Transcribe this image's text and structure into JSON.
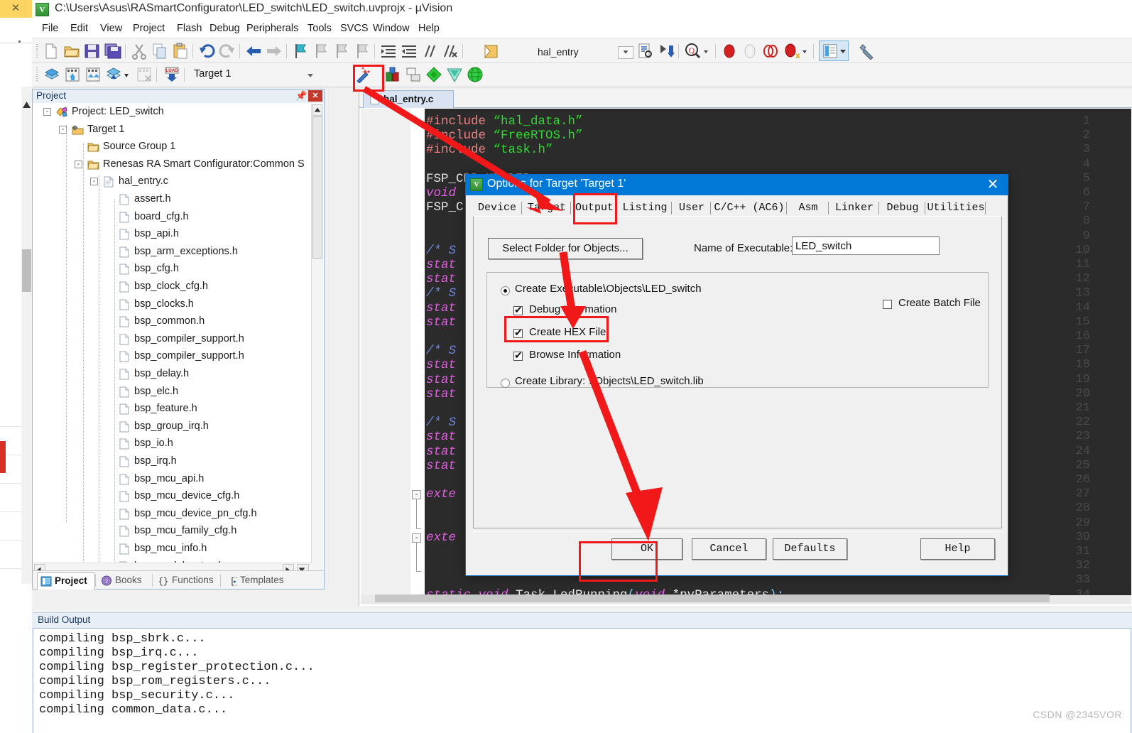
{
  "window": {
    "title": "C:\\Users\\Asus\\RASmartConfigurator\\LED_switch\\LED_switch.uvprojx - µVision",
    "app_icon_text": "V"
  },
  "menu": [
    "File",
    "Edit",
    "View",
    "Project",
    "Flash",
    "Debug",
    "Peripherals",
    "Tools",
    "SVCS",
    "Window",
    "Help"
  ],
  "toolbar": {
    "target_selected": "Target 1",
    "hal_entry_label": "hal_entry",
    "icons_row1": [
      "new-file-icon",
      "open-file-icon",
      "save-icon",
      "save-all-icon",
      "cut-icon",
      "copy-icon",
      "paste-icon",
      "undo-icon",
      "redo-icon",
      "back-icon",
      "forward-icon",
      "bookmark-icon",
      "bookmark-prev-icon",
      "bookmark-next-icon",
      "bookmark-clear-icon",
      "indent-icon",
      "outdent-icon",
      "comment-icon",
      "uncomment-icon",
      "notebook-icon",
      "find-in-files-icon",
      "insert-icon",
      "find-icon",
      "breakpoint-icon",
      "breakpoint-disable-icon",
      "breakpoint-clear-icon",
      "breakpoint-kill-icon",
      "window-layout-icon",
      "configure-icon"
    ],
    "icons_row2": [
      "translate-icon",
      "build-icon",
      "rebuild-icon",
      "batch-build-icon",
      "stop-build-icon",
      "download-icon",
      "wand-icon",
      "manage-runtime-icon",
      "manage-project-items-icon",
      "configuration-wizard-icon",
      "pack-installer-icon",
      "ra-configurator-icon"
    ]
  },
  "project_panel": {
    "title": "Project",
    "pin_icon": "pin-icon",
    "close_icon": "close-icon",
    "tree": [
      {
        "label": "Project: LED_switch",
        "depth": 0,
        "icon": "project-icon",
        "expander": "-"
      },
      {
        "label": "Target 1",
        "depth": 1,
        "icon": "target-folder-icon",
        "expander": "-"
      },
      {
        "label": "Source Group 1",
        "depth": 2,
        "icon": "folder-icon",
        "expander": ""
      },
      {
        "label": "Renesas RA Smart Configurator:Common S",
        "depth": 2,
        "icon": "folder-icon",
        "expander": "-"
      },
      {
        "label": "hal_entry.c",
        "depth": 3,
        "icon": "c-file-icon",
        "expander": "-"
      },
      {
        "label": "assert.h",
        "depth": 4,
        "icon": "header-file-icon",
        "expander": ""
      },
      {
        "label": "board_cfg.h",
        "depth": 4,
        "icon": "header-file-icon",
        "expander": ""
      },
      {
        "label": "bsp_api.h",
        "depth": 4,
        "icon": "header-file-icon",
        "expander": ""
      },
      {
        "label": "bsp_arm_exceptions.h",
        "depth": 4,
        "icon": "header-file-icon",
        "expander": ""
      },
      {
        "label": "bsp_cfg.h",
        "depth": 4,
        "icon": "header-file-icon",
        "expander": ""
      },
      {
        "label": "bsp_clock_cfg.h",
        "depth": 4,
        "icon": "header-file-icon",
        "expander": ""
      },
      {
        "label": "bsp_clocks.h",
        "depth": 4,
        "icon": "header-file-icon",
        "expander": ""
      },
      {
        "label": "bsp_common.h",
        "depth": 4,
        "icon": "header-file-icon",
        "expander": ""
      },
      {
        "label": "bsp_compiler_support.h",
        "depth": 4,
        "icon": "header-file-icon",
        "expander": ""
      },
      {
        "label": "bsp_compiler_support.h",
        "depth": 4,
        "icon": "header-file-icon",
        "expander": ""
      },
      {
        "label": "bsp_delay.h",
        "depth": 4,
        "icon": "header-file-icon",
        "expander": ""
      },
      {
        "label": "bsp_elc.h",
        "depth": 4,
        "icon": "header-file-icon",
        "expander": ""
      },
      {
        "label": "bsp_feature.h",
        "depth": 4,
        "icon": "header-file-icon",
        "expander": ""
      },
      {
        "label": "bsp_group_irq.h",
        "depth": 4,
        "icon": "header-file-icon",
        "expander": ""
      },
      {
        "label": "bsp_io.h",
        "depth": 4,
        "icon": "header-file-icon",
        "expander": ""
      },
      {
        "label": "bsp_irq.h",
        "depth": 4,
        "icon": "header-file-icon",
        "expander": ""
      },
      {
        "label": "bsp_mcu_api.h",
        "depth": 4,
        "icon": "header-file-icon",
        "expander": ""
      },
      {
        "label": "bsp_mcu_device_cfg.h",
        "depth": 4,
        "icon": "header-file-icon",
        "expander": ""
      },
      {
        "label": "bsp_mcu_device_pn_cfg.h",
        "depth": 4,
        "icon": "header-file-icon",
        "expander": ""
      },
      {
        "label": "bsp_mcu_family_cfg.h",
        "depth": 4,
        "icon": "header-file-icon",
        "expander": ""
      },
      {
        "label": "bsp_mcu_info.h",
        "depth": 4,
        "icon": "header-file-icon",
        "expander": ""
      },
      {
        "label": "bsp_module_stop.h",
        "depth": 4,
        "icon": "header-file-icon",
        "expander": ""
      }
    ],
    "tabs": [
      {
        "label": "Project",
        "icon": "project-tab-icon",
        "active": true
      },
      {
        "label": "Books",
        "icon": "books-tab-icon",
        "active": false
      },
      {
        "label": "Functions",
        "icon": "functions-tab-icon",
        "active": false
      },
      {
        "label": "Templates",
        "icon": "templates-tab-icon",
        "active": false
      }
    ]
  },
  "editor": {
    "tab_label": "hal_entry.c",
    "tab_icon": "c-file-icon",
    "lines": [
      {
        "n": 1,
        "tokens": [
          {
            "t": "#include ",
            "c": "c-pre"
          },
          {
            "t": "“hal_data.h”",
            "c": "c-str"
          }
        ]
      },
      {
        "n": 2,
        "tokens": [
          {
            "t": "#include ",
            "c": "c-pre"
          },
          {
            "t": "“FreeRTOS.h”",
            "c": "c-str"
          }
        ]
      },
      {
        "n": 3,
        "tokens": [
          {
            "t": "#include ",
            "c": "c-pre"
          },
          {
            "t": "“task.h”",
            "c": "c-str"
          }
        ]
      },
      {
        "n": 4,
        "tokens": []
      },
      {
        "n": 5,
        "tokens": [
          {
            "t": "FSP_CPP_HEADER",
            "c": "c-plain"
          }
        ]
      },
      {
        "n": 6,
        "tokens": [
          {
            "t": "void",
            "c": "c-kw"
          }
        ]
      },
      {
        "n": 7,
        "tokens": [
          {
            "t": "FSP_C",
            "c": "c-plain"
          }
        ]
      },
      {
        "n": 8,
        "tokens": []
      },
      {
        "n": 9,
        "tokens": []
      },
      {
        "n": 10,
        "tokens": [
          {
            "t": "/* S",
            "c": "c-cmt"
          }
        ]
      },
      {
        "n": 11,
        "tokens": [
          {
            "t": "stat",
            "c": "c-kw"
          }
        ]
      },
      {
        "n": 12,
        "tokens": [
          {
            "t": "stat",
            "c": "c-kw"
          }
        ]
      },
      {
        "n": 13,
        "tokens": [
          {
            "t": "/* S",
            "c": "c-cmt"
          }
        ]
      },
      {
        "n": 14,
        "tokens": [
          {
            "t": "stat",
            "c": "c-kw"
          }
        ]
      },
      {
        "n": 15,
        "tokens": [
          {
            "t": "stat",
            "c": "c-kw"
          }
        ]
      },
      {
        "n": 16,
        "tokens": []
      },
      {
        "n": 17,
        "tokens": [
          {
            "t": "/* S",
            "c": "c-cmt"
          }
        ]
      },
      {
        "n": 18,
        "tokens": [
          {
            "t": "stat",
            "c": "c-kw"
          }
        ]
      },
      {
        "n": 19,
        "tokens": [
          {
            "t": "stat",
            "c": "c-kw"
          }
        ]
      },
      {
        "n": 20,
        "tokens": [
          {
            "t": "stat",
            "c": "c-kw"
          }
        ]
      },
      {
        "n": 21,
        "tokens": []
      },
      {
        "n": 22,
        "tokens": [
          {
            "t": "/* S",
            "c": "c-cmt"
          }
        ]
      },
      {
        "n": 23,
        "tokens": [
          {
            "t": "stat",
            "c": "c-kw"
          }
        ]
      },
      {
        "n": 24,
        "tokens": [
          {
            "t": "stat",
            "c": "c-kw"
          }
        ]
      },
      {
        "n": 25,
        "tokens": [
          {
            "t": "stat",
            "c": "c-kw"
          }
        ]
      },
      {
        "n": 26,
        "tokens": []
      },
      {
        "n": 27,
        "tokens": [
          {
            "t": "exte",
            "c": "c-kw"
          }
        ],
        "fold": "-"
      },
      {
        "n": 28,
        "tokens": []
      },
      {
        "n": 29,
        "tokens": []
      },
      {
        "n": 30,
        "tokens": [
          {
            "t": "exte",
            "c": "c-kw"
          }
        ],
        "fold": "-"
      },
      {
        "n": 31,
        "tokens": []
      },
      {
        "n": 32,
        "tokens": []
      },
      {
        "n": 33,
        "tokens": []
      },
      {
        "n": 34,
        "tokens": [
          {
            "t": "static void ",
            "c": "c-kw"
          },
          {
            "t": "Task_LedRunning",
            "c": "c-id"
          },
          {
            "t": "(",
            "c": "c-op"
          },
          {
            "t": "void ",
            "c": "c-kw"
          },
          {
            "t": "*pvParameters",
            "c": "c-id"
          },
          {
            "t": ");",
            "c": "c-op"
          }
        ]
      }
    ]
  },
  "dialog": {
    "title": "Options for Target 'Target 1'",
    "icon": "uvision-icon",
    "close_icon": "close-icon",
    "tabs": [
      {
        "label": "Device",
        "active": false
      },
      {
        "label": "Target",
        "active": false
      },
      {
        "label": "Output",
        "active": true
      },
      {
        "label": "Listing",
        "active": false
      },
      {
        "label": "User",
        "active": false
      },
      {
        "label": "C/C++ (AC6)",
        "active": false
      },
      {
        "label": "Asm",
        "active": false
      },
      {
        "label": "Linker",
        "active": false
      },
      {
        "label": "Debug",
        "active": false
      },
      {
        "label": "Utilities",
        "active": false
      }
    ],
    "select_folder_button": "Select Folder for Objects...",
    "name_of_executable_label": "Name of Executable:",
    "name_of_executable_value": "LED_switch",
    "create_executable_label": "Create Executable:",
    "create_executable_path": ".\\Objects\\LED_switch",
    "create_executable_checked": true,
    "debug_information_label": "Debug Information",
    "debug_information_checked": true,
    "create_hex_label": "Create HEX File",
    "create_hex_checked": true,
    "browse_information_label": "Browse Information",
    "browse_information_checked": true,
    "create_library_label": "Create Library:",
    "create_library_path": ".\\Objects\\LED_switch.lib",
    "create_library_checked": false,
    "create_batch_label": "Create Batch File",
    "create_batch_checked": false,
    "buttons": [
      {
        "label": "OK",
        "name": "ok-button"
      },
      {
        "label": "Cancel",
        "name": "cancel-button"
      },
      {
        "label": "Defaults",
        "name": "defaults-button"
      },
      {
        "label": "Help",
        "name": "help-button"
      }
    ]
  },
  "build_output": {
    "title": "Build Output",
    "lines": [
      "compiling bsp_sbrk.c...",
      "compiling bsp_irq.c...",
      "compiling bsp_register_protection.c...",
      "compiling bsp_rom_registers.c...",
      "compiling bsp_security.c...",
      "compiling common_data.c..."
    ]
  },
  "watermark": "CSDN @2345VOR",
  "annotation": {
    "color": "#f01818",
    "highlights": [
      "ra-configurator-toolbar-button",
      "output-tab",
      "create-hex-file-checkbox",
      "ok-button"
    ]
  }
}
